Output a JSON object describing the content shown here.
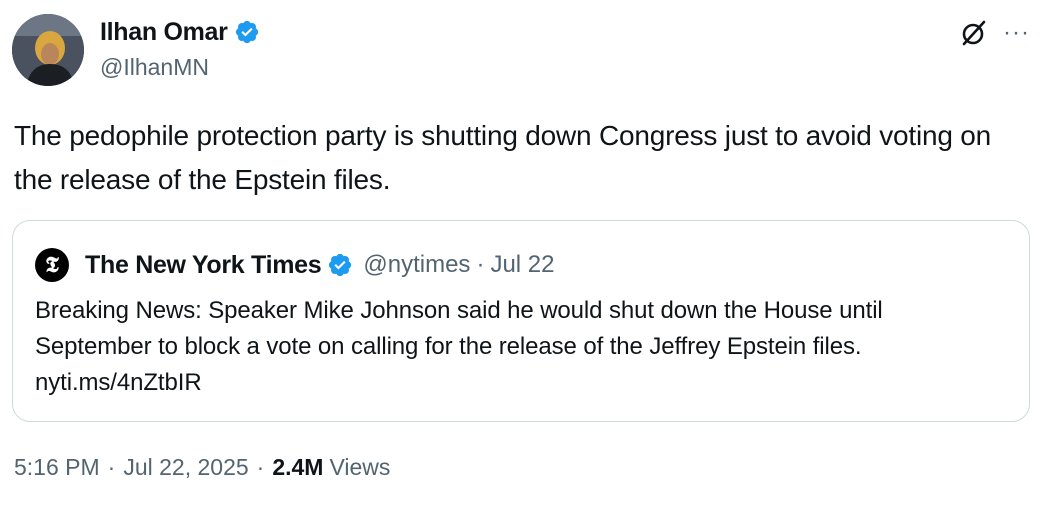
{
  "author": {
    "display_name": "Ilhan Omar",
    "handle": "@IlhanMN",
    "verified": true,
    "verified_color": "#1d9bf0"
  },
  "actions": {
    "grok_icon": "grok-icon",
    "more_label": "···"
  },
  "tweet": {
    "text": "The pedophile protection party is shutting down Congress just to avoid voting on the release of the Epstein files."
  },
  "quote": {
    "logo_glyph": "𝕿",
    "display_name": "The New York Times",
    "handle": "@nytimes",
    "separator": "·",
    "date": "Jul 22",
    "text": "Breaking News: Speaker Mike Johnson said he would shut down the House until September to block a vote on calling for the release of the Jeffrey Epstein files. nyti.ms/4nZtbIR"
  },
  "meta": {
    "time": "5:16 PM",
    "separator": "·",
    "date": "Jul 22, 2025",
    "views_count": "2.4M",
    "views_label": "Views"
  },
  "colors": {
    "text": "#0f1419",
    "secondary": "#536471",
    "border": "#cfd9de",
    "verified": "#1d9bf0"
  }
}
